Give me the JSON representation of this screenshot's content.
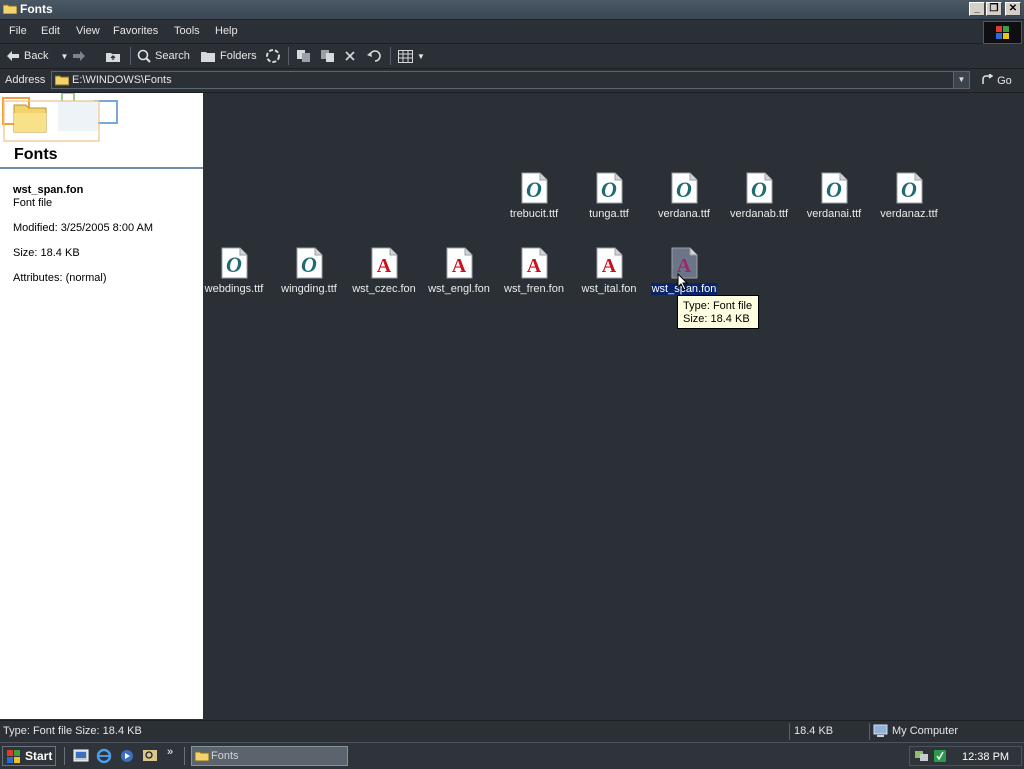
{
  "window": {
    "title": "Fonts"
  },
  "menu": [
    "File",
    "Edit",
    "View",
    "Favorites",
    "Tools",
    "Help"
  ],
  "toolbar": {
    "back_label": "Back",
    "search_label": "Search",
    "folders_label": "Folders"
  },
  "address": {
    "label": "Address",
    "path": "E:\\WINDOWS\\Fonts",
    "go_label": "Go"
  },
  "details": {
    "heading": "Fonts",
    "file_name": "wst_span.fon",
    "file_type": "Font file",
    "modified": "Modified: 3/25/2005 8:00 AM",
    "size": "Size: 18.4 KB",
    "attributes": "Attributes: (normal)"
  },
  "files": [
    {
      "name": "trebucit.ttf",
      "icon": "opentype-font-icon"
    },
    {
      "name": "tunga.ttf",
      "icon": "opentype-font-icon"
    },
    {
      "name": "verdana.ttf",
      "icon": "opentype-font-icon"
    },
    {
      "name": "verdanab.ttf",
      "icon": "opentype-font-icon"
    },
    {
      "name": "verdanai.ttf",
      "icon": "opentype-font-icon"
    },
    {
      "name": "verdanaz.ttf",
      "icon": "opentype-font-icon"
    },
    {
      "name": "webdings.ttf",
      "icon": "opentype-font-icon"
    },
    {
      "name": "wingding.ttf",
      "icon": "opentype-font-icon"
    },
    {
      "name": "wst_czec.fon",
      "icon": "bitmap-font-icon"
    },
    {
      "name": "wst_engl.fon",
      "icon": "bitmap-font-icon"
    },
    {
      "name": "wst_fren.fon",
      "icon": "bitmap-font-icon"
    },
    {
      "name": "wst_ital.fon",
      "icon": "bitmap-font-icon"
    },
    {
      "name": "wst_span.fon",
      "icon": "bitmap-font-icon",
      "selected": true
    }
  ],
  "tooltip": {
    "type": "Type: Font file",
    "size": "Size: 18.4 KB"
  },
  "status": {
    "description": "Type: Font file Size: 18.4 KB",
    "size": "18.4 KB",
    "zone": "My Computer"
  },
  "taskbar": {
    "start_label": "Start",
    "task_label": "Fonts",
    "clock": "12:38 PM"
  },
  "colors": {
    "background": "#2b3036",
    "selection": "#0a246a",
    "tooltip": "#ffffe1",
    "font_glyph_teal": "#1f6b74",
    "font_glyph_red": "#cc1020"
  }
}
